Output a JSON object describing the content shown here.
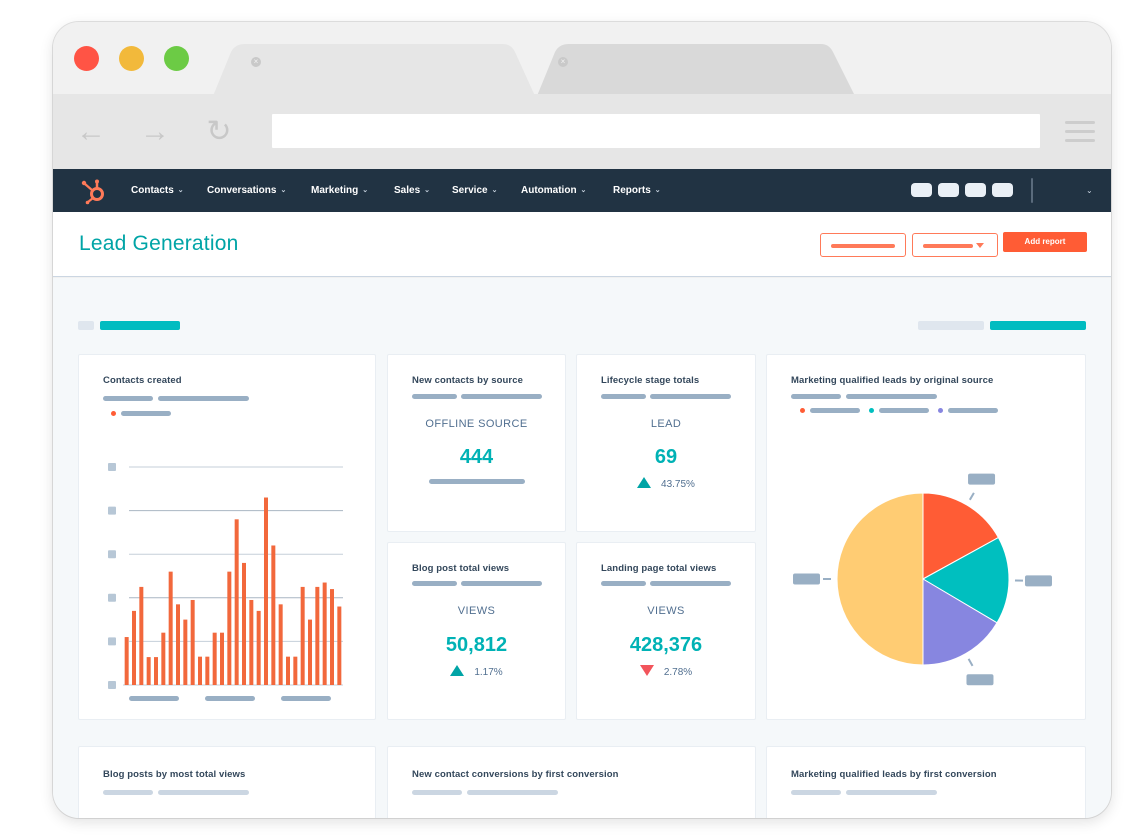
{
  "browser": {
    "window_controls": [
      {
        "name": "close",
        "color": "#ff5445"
      },
      {
        "name": "minimize",
        "color": "#f2b93b"
      },
      {
        "name": "maximize",
        "color": "#6ccb45"
      }
    ],
    "tabs": [
      {
        "close_glyph": "×",
        "active": true
      },
      {
        "close_glyph": "×",
        "active": false
      }
    ],
    "nav": {
      "back_glyph": "←",
      "forward_glyph": "→",
      "reload_glyph": "↻"
    },
    "url": ""
  },
  "app_nav": {
    "logo": "hubspot-sprocket-icon",
    "items": [
      {
        "label": "Contacts",
        "chevron": "⌄"
      },
      {
        "label": "Conversations",
        "chevron": "⌄"
      },
      {
        "label": "Marketing",
        "chevron": "⌄"
      },
      {
        "label": "Sales",
        "chevron": "⌄"
      },
      {
        "label": "Service",
        "chevron": "⌄"
      },
      {
        "label": "Automation",
        "chevron": "⌄"
      },
      {
        "label": "Reports",
        "chevron": "⌄"
      }
    ],
    "account_chevron": "⌄"
  },
  "page": {
    "title": "Lead Generation",
    "add_report_label": "Add report"
  },
  "colors": {
    "accent_teal": "#00bcc0",
    "brand_orange": "#ff5c35",
    "nav_dark": "#213343",
    "positive": "#00a4a6",
    "negative": "#f2545b"
  },
  "cards": {
    "contacts_created": {
      "title": "Contacts created"
    },
    "new_contacts_by_source": {
      "title": "New contacts by source",
      "label": "OFFLINE SOURCE",
      "value": "444"
    },
    "lifecycle_stage_totals": {
      "title": "Lifecycle stage totals",
      "label": "LEAD",
      "value": "69",
      "change": "43.75%",
      "direction": "up"
    },
    "blog_post_total_views": {
      "title": "Blog post total views",
      "label": "VIEWS",
      "value": "50,812",
      "change": "1.17%",
      "direction": "up"
    },
    "landing_page_total_views": {
      "title": "Landing page total views",
      "label": "VIEWS",
      "value": "428,376",
      "change": "2.78%",
      "direction": "down"
    },
    "mql_by_original_source": {
      "title": "Marketing qualified leads by original source"
    },
    "blog_posts_by_most_views": {
      "title": "Blog posts by most total views"
    },
    "new_contact_conversions": {
      "title": "New contact conversions by first conversion"
    },
    "mql_by_first_conversion": {
      "title": "Marketing qualified leads by first conversion"
    }
  },
  "chart_data": [
    {
      "type": "bar",
      "title": "Contacts created",
      "xlabel": "",
      "ylabel": "",
      "ylim": [
        0,
        5
      ],
      "grid": true,
      "legend": "top-left",
      "color": "#f2683c",
      "values": [
        1.1,
        1.7,
        2.25,
        0.64,
        0.64,
        1.2,
        2.6,
        1.85,
        1.5,
        1.95,
        0.65,
        0.65,
        1.2,
        1.2,
        2.6,
        3.8,
        2.8,
        1.95,
        1.7,
        4.3,
        3.2,
        1.85,
        0.65,
        0.65,
        2.25,
        1.5,
        2.25,
        2.35,
        2.2,
        1.8
      ]
    },
    {
      "type": "pie",
      "title": "Marketing qualified leads by original source",
      "legend": "top-left",
      "slices": [
        {
          "value": 17,
          "color": "#ff5c35"
        },
        {
          "value": 16.5,
          "color": "#00bfbf"
        },
        {
          "value": 16.5,
          "color": "#8786e0"
        },
        {
          "value": 50,
          "color": "#ffcc73"
        }
      ]
    }
  ]
}
